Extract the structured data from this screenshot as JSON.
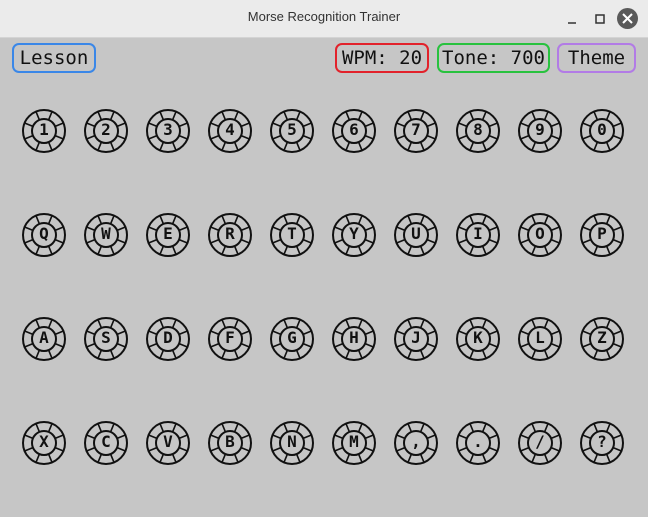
{
  "window": {
    "title": "Morse Recognition Trainer"
  },
  "toolbar": {
    "lesson_label": "Lesson",
    "wpm_label": "WPM: 20",
    "tone_label": "Tone: 700",
    "theme_label": "Theme"
  },
  "colors": {
    "background": "#c6c6c6",
    "lesson_border": "#3a87e8",
    "wpm_border": "#e2222b",
    "tone_border": "#28c23e",
    "theme_border": "#b27be6"
  },
  "keyboard": {
    "rows": [
      [
        "1",
        "2",
        "3",
        "4",
        "5",
        "6",
        "7",
        "8",
        "9",
        "0"
      ],
      [
        "Q",
        "W",
        "E",
        "R",
        "T",
        "Y",
        "U",
        "I",
        "O",
        "P"
      ],
      [
        "A",
        "S",
        "D",
        "F",
        "G",
        "H",
        "J",
        "K",
        "L",
        "Z"
      ],
      [
        "X",
        "C",
        "V",
        "B",
        "N",
        "M",
        ",",
        ".",
        "/",
        "?"
      ]
    ]
  }
}
